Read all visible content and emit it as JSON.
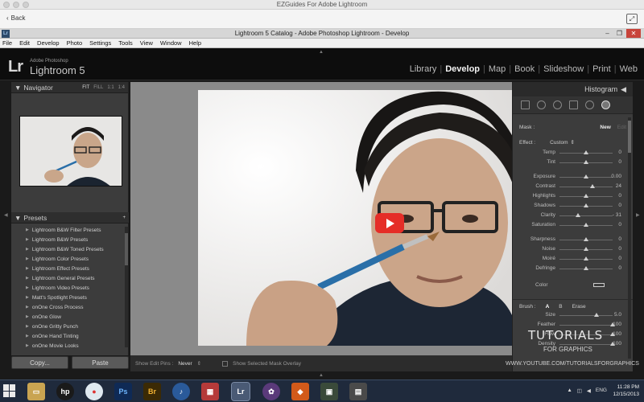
{
  "mac_window": {
    "title": "EZGuides For Adobe Lightroom",
    "back_label": "Back"
  },
  "windows_title": {
    "text": "Lightroom 5 Catalog - Adobe Photoshop Lightroom - Develop",
    "app_icon": "Lr"
  },
  "menu": [
    "File",
    "Edit",
    "Develop",
    "Photo",
    "Settings",
    "Tools",
    "View",
    "Window",
    "Help"
  ],
  "lr_header": {
    "logo": "Lr",
    "adobe": "Adobe Photoshop",
    "product": "Lightroom 5",
    "modules": [
      "Library",
      "Develop",
      "Map",
      "Book",
      "Slideshow",
      "Print",
      "Web"
    ],
    "active_module": "Develop"
  },
  "navigator": {
    "title": "Navigator",
    "options": [
      "FIT",
      "FILL",
      "1:1",
      "1:4"
    ]
  },
  "presets": {
    "title": "Presets",
    "items": [
      "Lightroom B&W Filter Presets",
      "Lightroom B&W Presets",
      "Lightroom B&W Toned Presets",
      "Lightroom Color Presets",
      "Lightroom Effect Presets",
      "Lightroom General Presets",
      "Lightroom Video Presets",
      "Matt's Spotlight Presets",
      "onOne Cross Process",
      "onOne Glow",
      "onOne Gritty Punch",
      "onOne Hand Tinting",
      "onOne Movie Looks"
    ]
  },
  "left_buttons": {
    "copy": "Copy...",
    "paste": "Paste"
  },
  "toolbar": {
    "show_edit_pins": "Show Edit Pins :",
    "edit_pins_value": "Never",
    "show_mask": "Show Selected Mask Overlay"
  },
  "right_panel": {
    "histogram": "Histogram",
    "mask_label": "Mask :",
    "mask_new": "New",
    "mask_edit": "Edit",
    "effect_label": "Effect :",
    "effect_value": "Custom",
    "sliders": [
      {
        "label": "Temp",
        "value": "0",
        "pos": 0.5
      },
      {
        "label": "Tint",
        "value": "0",
        "pos": 0.5
      },
      {
        "label": "Exposure",
        "value": "0.00",
        "pos": 0.5
      },
      {
        "label": "Contrast",
        "value": "24",
        "pos": 0.62
      },
      {
        "label": "Highlights",
        "value": "0",
        "pos": 0.5
      },
      {
        "label": "Shadows",
        "value": "0",
        "pos": 0.5
      },
      {
        "label": "Clarity",
        "value": "- 31",
        "pos": 0.35
      },
      {
        "label": "Saturation",
        "value": "0",
        "pos": 0.5
      },
      {
        "label": "Sharpness",
        "value": "0",
        "pos": 0.5
      },
      {
        "label": "Noise",
        "value": "0",
        "pos": 0.5
      },
      {
        "label": "Moiré",
        "value": "0",
        "pos": 0.5
      },
      {
        "label": "Defringe",
        "value": "0",
        "pos": 0.5
      }
    ],
    "color_label": "Color",
    "brush_label": "Brush :",
    "brush_a": "A",
    "brush_b": "B",
    "brush_erase": "Erase",
    "brush_sliders": [
      {
        "label": "Size",
        "value": "5.0",
        "pos": 0.7
      },
      {
        "label": "Feather",
        "value": "100",
        "pos": 1.0
      },
      {
        "label": "Flow",
        "value": "100",
        "pos": 1.0
      },
      {
        "label": "Density",
        "value": "100",
        "pos": 1.0
      }
    ]
  },
  "watermark": {
    "line1": "TUTORIALS",
    "line2": "FOR GRAPHICS",
    "url": "WWW.YOUTUBE.COM/TUTORIALSFORGRAPHICS"
  },
  "taskbar": {
    "time": "11:28 PM",
    "date": "12/15/2013",
    "lang": "ENG"
  }
}
